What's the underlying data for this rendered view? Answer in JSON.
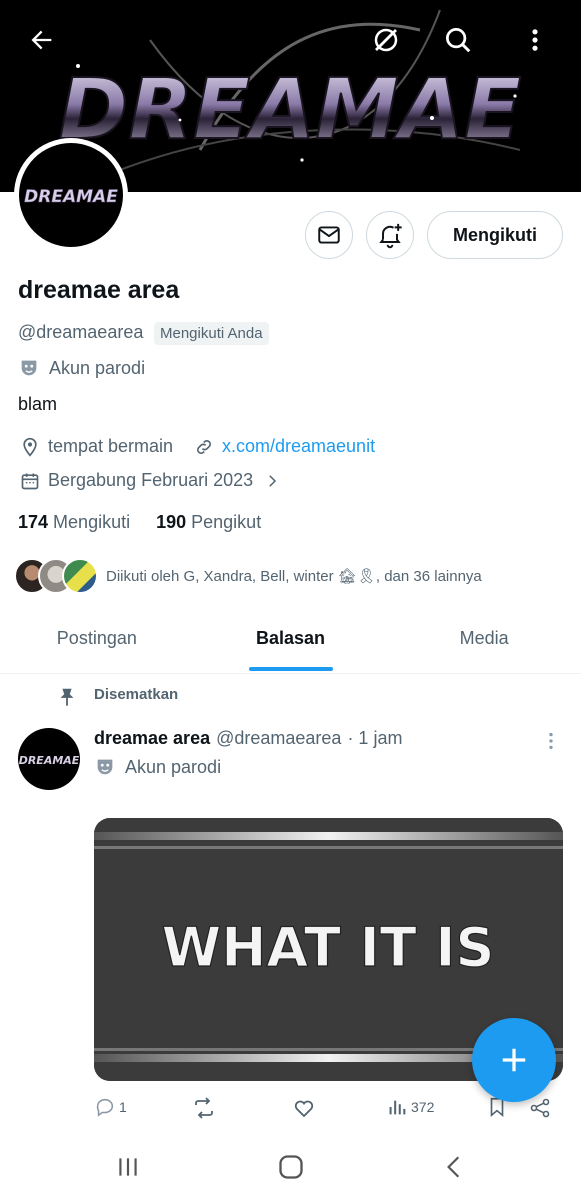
{
  "banner": {
    "logo_text": "DREAMAE"
  },
  "header_icons": [
    "back-arrow-icon",
    "grok-icon",
    "search-icon",
    "more-vertical-icon"
  ],
  "profile": {
    "avatar_text": "DREAMAE",
    "name": "dreamae area",
    "handle": "@dreamaearea",
    "follows_you": "Mengikuti Anda",
    "parody_label": "Akun parodi",
    "bio": "blam",
    "location": "tempat bermain",
    "website": "x.com/dreamaeunit",
    "joined": "Bergabung Februari 2023",
    "following_count": "174",
    "following_label": "Mengikuti",
    "followers_count": "190",
    "followers_label": "Pengikut",
    "followed_by": "Diikuti oleh G, Xandra, Bell, winter 🏚🎗, dan 36 lainnya"
  },
  "actions": {
    "follow_button": "Mengikuti"
  },
  "tabs": [
    {
      "label": "Postingan",
      "active": false
    },
    {
      "label": "Balasan",
      "active": true
    },
    {
      "label": "Media",
      "active": false
    }
  ],
  "post": {
    "pinned_label": "Disematkan",
    "name": "dreamae area",
    "handle": "@dreamaearea",
    "time": "· 1 jam",
    "parody_label": "Akun parodi",
    "image_text": "WHAT IT IS",
    "reply_count": "1",
    "view_count": "372"
  },
  "colors": {
    "accent": "#1d9bf0",
    "text": "#0f1419",
    "muted": "#536471",
    "border": "#cfd9de"
  }
}
